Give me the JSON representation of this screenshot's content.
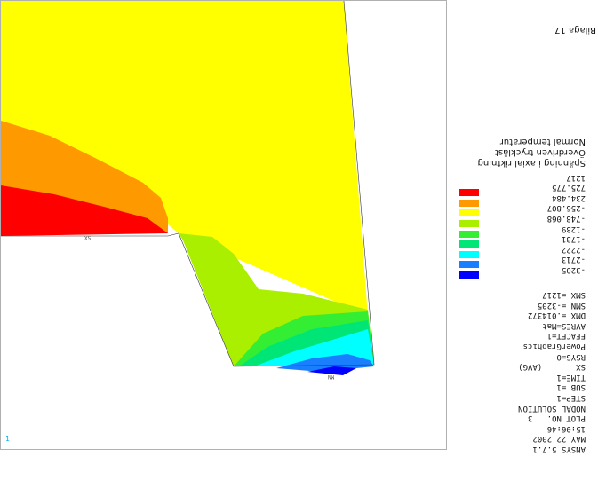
{
  "info": {
    "lines": [
      "ANSYS 5.7.1",
      "MAY 22 2002",
      "15:06:46",
      "PLOT NO.   3",
      "NODAL SOLUTION",
      "STEP=1",
      "SUB =1",
      "TIME=1",
      "SX       (AVG)",
      "RSYS=0",
      "PowerGraphics",
      "EFACET=1",
      "AVRES=Mat",
      "DMX =.014372",
      "SMN =-3205",
      "SMX =1217"
    ]
  },
  "legend": [
    {
      "value": "-3205",
      "color": "#0000ff"
    },
    {
      "value": "-2713",
      "color": "#1a7fff"
    },
    {
      "value": "-2222",
      "color": "#00ffff"
    },
    {
      "value": "-1731",
      "color": "#00e676"
    },
    {
      "value": "-1239",
      "color": "#33ee33"
    },
    {
      "value": "-748.068",
      "color": "#aaee00"
    },
    {
      "value": "-256.807",
      "color": "#ffff00"
    },
    {
      "value": "234.484",
      "color": "#ff9900"
    },
    {
      "value": "725.775",
      "color": "#ff0000"
    },
    {
      "value": "1217",
      "color": ""
    }
  ],
  "titles": [
    "Spänning i axial riktning",
    "Överdriven tryckläst",
    "Normal temperatur"
  ],
  "caption": "Bilaga 17",
  "markers": {
    "sx": "SX",
    "mn": "MN",
    "triad": "1"
  }
}
